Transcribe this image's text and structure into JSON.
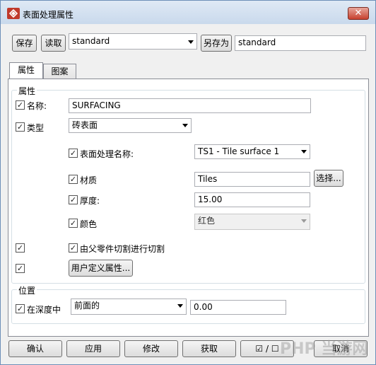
{
  "window": {
    "title": "表面处理属性",
    "close_glyph": "✕"
  },
  "toolbar": {
    "save_label": "保存",
    "load_label": "读取",
    "preset_value": "standard",
    "save_as_label": "另存为",
    "save_as_value": "standard"
  },
  "tabs": [
    {
      "label": "属性",
      "active": true
    },
    {
      "label": "图案",
      "active": false
    }
  ],
  "attributes_group": {
    "title": "属性",
    "name_label": "名称:",
    "name_value": "SURFACING",
    "type_label": "类型",
    "type_value": "砖表面",
    "surface_name_label": "表面处理名称:",
    "surface_name_value": "TS1 - Tile surface 1",
    "material_label": "材质",
    "material_value": "Tiles",
    "select_button": "选择...",
    "thickness_label": "厚度:",
    "thickness_value": "15.00",
    "color_label": "颜色",
    "color_value": "红色",
    "cut_by_parent_label": "由父零件切割进行切割",
    "udf_button": "用户定义属性..."
  },
  "position_group": {
    "title": "位置",
    "depth_label": "在深度中",
    "depth_value": "前面的",
    "depth_offset": "0.00"
  },
  "footer": {
    "ok_label": "确认",
    "apply_label": "应用",
    "modify_label": "修改",
    "get_label": "获取",
    "toggle_label": "☑ / ☐",
    "cancel_label": "取消"
  },
  "check_glyph": "✓",
  "watermark": "PHP 当游网"
}
